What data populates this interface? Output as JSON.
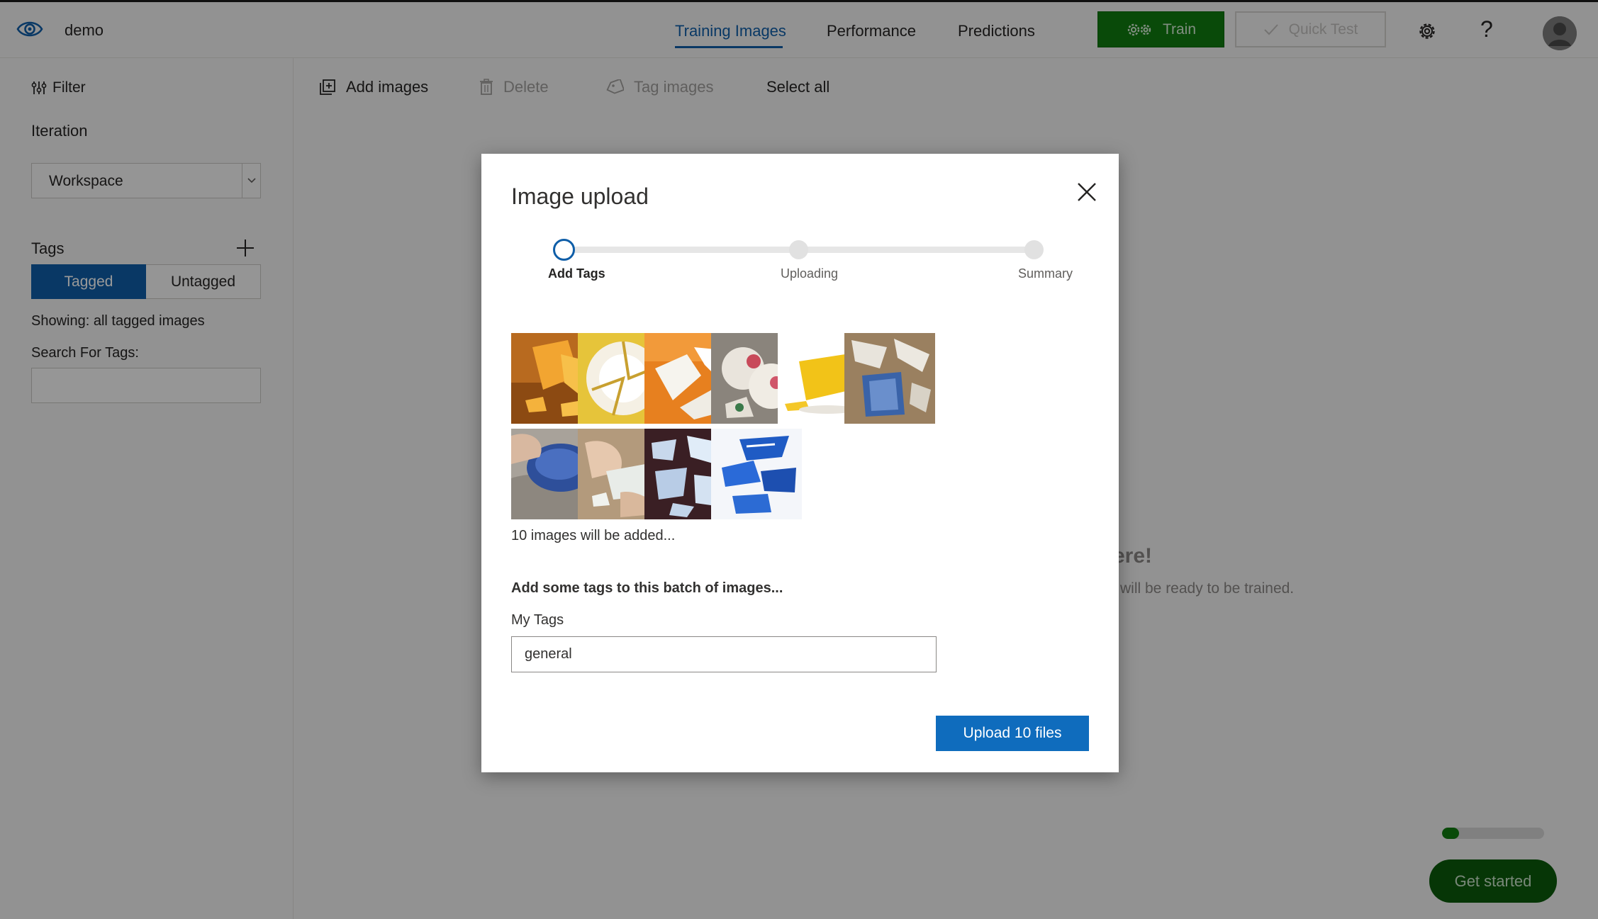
{
  "header": {
    "project_name": "demo",
    "tabs": [
      {
        "label": "Training Images"
      },
      {
        "label": "Performance"
      },
      {
        "label": "Predictions"
      }
    ],
    "train_label": "Train",
    "quick_test_label": "Quick Test",
    "help_glyph": "?"
  },
  "sidebar": {
    "filter_label": "Filter",
    "iteration_label": "Iteration",
    "iteration_value": "Workspace",
    "tags_label": "Tags",
    "tagged_label": "Tagged",
    "untagged_label": "Untagged",
    "showing_text": "Showing: all tagged images",
    "search_label": "Search For Tags:"
  },
  "toolbar": {
    "add_images": "Add images",
    "delete": "Delete",
    "tag_images": "Tag images",
    "select_all": "Select all"
  },
  "background": {
    "headline_fragment": "ere!",
    "ready_fragment": "will be ready to be trained.",
    "get_started": "Get started",
    "progress": 0.17
  },
  "modal": {
    "title": "Image upload",
    "steps": [
      {
        "label": "Add Tags",
        "state": "current"
      },
      {
        "label": "Uploading",
        "state": "pending"
      },
      {
        "label": "Summary",
        "state": "pending"
      }
    ],
    "images_count_text": "10 images will be added...",
    "add_tags_prompt": "Add some tags to this batch of images...",
    "my_tags_label": "My Tags",
    "tag_value": "general",
    "upload_label": "Upload 10 files"
  },
  "colors": {
    "accent_blue": "#0f5ea8",
    "train_green": "#107c10",
    "get_started_green": "#0b5a0b"
  },
  "icons": [
    "eye-icon",
    "gear-icon",
    "help-icon",
    "avatar-icon",
    "filter-icon",
    "add-icon",
    "chevron-down-icon",
    "add-images-icon",
    "delete-icon",
    "tag-icon",
    "close-icon",
    "checkmark-icon"
  ]
}
